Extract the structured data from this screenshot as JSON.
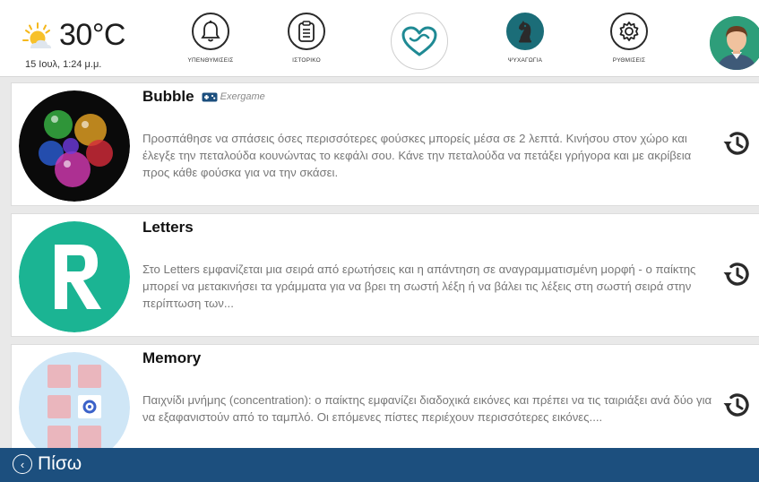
{
  "weather": {
    "temperature": "30°C",
    "datetime": "15 Ιουλ, 1:24 μ.μ.",
    "icon": "sun-cloud-icon"
  },
  "nav": {
    "reminders": {
      "label": "ΥΠΕΝΘΥΜΙΣΕΙΣ",
      "icon": "bell-icon"
    },
    "history": {
      "label": "ΙΣΤΟΡΙΚΟ",
      "icon": "clipboard-icon"
    },
    "home": {
      "icon": "heart-icon"
    },
    "entertainment": {
      "label": "ΨΥΧΑΓΩΓΙΑ",
      "icon": "chess-knight-icon"
    },
    "settings": {
      "label": "ΡΥΘΜΙΣΕΙΣ",
      "icon": "gear-icon"
    },
    "profile": {
      "icon": "user-avatar-icon"
    }
  },
  "games": [
    {
      "title": "Bubble",
      "badge": "Exergame",
      "badge_icon": "gamepad-icon",
      "description": "Προσπάθησε να σπάσεις όσες περισσότερες φούσκες μπορείς μέσα σε 2 λεπτά. Κινήσου στον χώρο και έλεγξε την πεταλούδα κουνώντας το κεφάλι σου. Κάνε την πεταλούδα να πετάξει γρήγορα και με ακρίβεια προς κάθε φούσκα για να την σκάσει.",
      "history_icon": "history-icon"
    },
    {
      "title": "Letters",
      "description": "Στο Letters εμφανίζεται μια σειρά από ερωτήσεις και η απάντηση σε αναγραμματισμένη μορφή - ο παίκτης μπορεί να μετακινήσει τα γράμματα για να βρει τη σωστή λέξη ή να βάλει τις λέξεις στη σωστή σειρά στην περίπτωση των...",
      "history_icon": "history-icon"
    },
    {
      "title": "Memory",
      "description": "Παιχνίδι μνήμης (concentration): ο παίκτης εμφανίζει διαδοχικά εικόνες και πρέπει να τις ταιριάξει ανά δύο για να εξαφανιστούν από το ταμπλό. Οι επόμενες πίστες περιέχουν περισσότερες εικόνες....",
      "history_icon": "history-icon"
    }
  ],
  "footer": {
    "back_label": "Πίσω",
    "back_icon": "chevron-left-icon"
  },
  "colors": {
    "footer_bg": "#1c4f7e",
    "active_nav": "#1b6d78",
    "heart": "#1f8a94",
    "avatar_bg": "#2e9e7a"
  }
}
